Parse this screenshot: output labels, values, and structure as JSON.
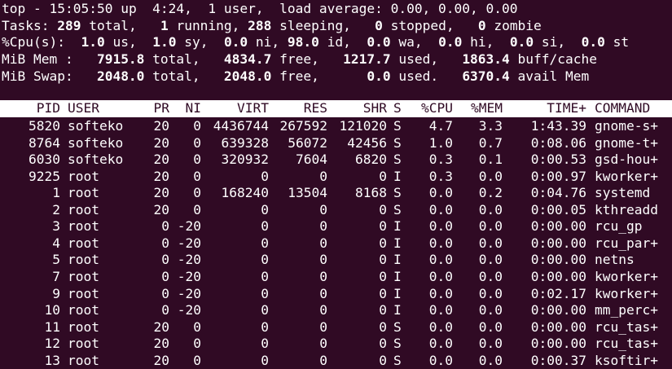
{
  "summary": {
    "uptime_line": {
      "prefix": "top - ",
      "time": "15:05:50",
      "up_label": " up ",
      "uptime": " 4:24,",
      "users": "  1 user,",
      "load_label": "  load average: ",
      "load": "0.00, 0.00, 0.00"
    },
    "tasks": {
      "label": "Tasks: ",
      "total": "289",
      "total_label": " total,   ",
      "running": "1",
      "running_label": " running, ",
      "sleeping": "288",
      "sleeping_label": " sleeping,   ",
      "stopped": "0",
      "stopped_label": " stopped,   ",
      "zombie": "0",
      "zombie_label": " zombie"
    },
    "cpu": {
      "label": "%Cpu(s):  ",
      "us": "1.0",
      "us_label": " us,  ",
      "sy": "1.0",
      "sy_label": " sy,  ",
      "ni": "0.0",
      "ni_label": " ni, ",
      "id": "98.0",
      "id_label": " id,  ",
      "wa": "0.0",
      "wa_label": " wa,  ",
      "hi": "0.0",
      "hi_label": " hi,  ",
      "si": "0.0",
      "si_label": " si,  ",
      "st": "0.0",
      "st_label": " st"
    },
    "mem": {
      "label": "MiB Mem :   ",
      "total": "7915.8",
      "total_label": " total,   ",
      "free": "4834.7",
      "free_label": " free,   ",
      "used": "1217.7",
      "used_label": " used,   ",
      "buff": "1863.4",
      "buff_label": " buff/cache"
    },
    "swap": {
      "label": "MiB Swap:   ",
      "total": "2048.0",
      "total_label": " total,   ",
      "free": "2048.0",
      "free_label": " free,      ",
      "used": "0.0",
      "used_label": " used.   ",
      "avail": "6370.4",
      "avail_label": " avail Mem"
    }
  },
  "table": {
    "headers": {
      "pid": "PID",
      "user": "USER",
      "pr": "PR",
      "ni": "NI",
      "virt": "VIRT",
      "res": "RES",
      "shr": "SHR",
      "s": "S",
      "cpu": "%CPU",
      "mem": "%MEM",
      "time": "TIME+",
      "command": "COMMAND"
    },
    "rows": [
      {
        "pid": "5820",
        "user": "softeko",
        "pr": "20",
        "ni": "0",
        "virt": "4436744",
        "res": "267592",
        "shr": "121020",
        "s": "S",
        "cpu": "4.7",
        "mem": "3.3",
        "time": "1:43.39",
        "command": "gnome-s+"
      },
      {
        "pid": "8764",
        "user": "softeko",
        "pr": "20",
        "ni": "0",
        "virt": "639328",
        "res": "56072",
        "shr": "42456",
        "s": "S",
        "cpu": "1.0",
        "mem": "0.7",
        "time": "0:08.06",
        "command": "gnome-t+"
      },
      {
        "pid": "6030",
        "user": "softeko",
        "pr": "20",
        "ni": "0",
        "virt": "320932",
        "res": "7604",
        "shr": "6820",
        "s": "S",
        "cpu": "0.3",
        "mem": "0.1",
        "time": "0:00.53",
        "command": "gsd-hou+"
      },
      {
        "pid": "9225",
        "user": "root",
        "pr": "20",
        "ni": "0",
        "virt": "0",
        "res": "0",
        "shr": "0",
        "s": "I",
        "cpu": "0.3",
        "mem": "0.0",
        "time": "0:00.97",
        "command": "kworker+"
      },
      {
        "pid": "1",
        "user": "root",
        "pr": "20",
        "ni": "0",
        "virt": "168240",
        "res": "13504",
        "shr": "8168",
        "s": "S",
        "cpu": "0.0",
        "mem": "0.2",
        "time": "0:04.76",
        "command": "systemd"
      },
      {
        "pid": "2",
        "user": "root",
        "pr": "20",
        "ni": "0",
        "virt": "0",
        "res": "0",
        "shr": "0",
        "s": "S",
        "cpu": "0.0",
        "mem": "0.0",
        "time": "0:00.05",
        "command": "kthreadd"
      },
      {
        "pid": "3",
        "user": "root",
        "pr": "0",
        "ni": "-20",
        "virt": "0",
        "res": "0",
        "shr": "0",
        "s": "I",
        "cpu": "0.0",
        "mem": "0.0",
        "time": "0:00.00",
        "command": "rcu_gp"
      },
      {
        "pid": "4",
        "user": "root",
        "pr": "0",
        "ni": "-20",
        "virt": "0",
        "res": "0",
        "shr": "0",
        "s": "I",
        "cpu": "0.0",
        "mem": "0.0",
        "time": "0:00.00",
        "command": "rcu_par+"
      },
      {
        "pid": "5",
        "user": "root",
        "pr": "0",
        "ni": "-20",
        "virt": "0",
        "res": "0",
        "shr": "0",
        "s": "I",
        "cpu": "0.0",
        "mem": "0.0",
        "time": "0:00.00",
        "command": "netns"
      },
      {
        "pid": "7",
        "user": "root",
        "pr": "0",
        "ni": "-20",
        "virt": "0",
        "res": "0",
        "shr": "0",
        "s": "I",
        "cpu": "0.0",
        "mem": "0.0",
        "time": "0:00.00",
        "command": "kworker+"
      },
      {
        "pid": "9",
        "user": "root",
        "pr": "0",
        "ni": "-20",
        "virt": "0",
        "res": "0",
        "shr": "0",
        "s": "I",
        "cpu": "0.0",
        "mem": "0.0",
        "time": "0:02.17",
        "command": "kworker+"
      },
      {
        "pid": "10",
        "user": "root",
        "pr": "0",
        "ni": "-20",
        "virt": "0",
        "res": "0",
        "shr": "0",
        "s": "I",
        "cpu": "0.0",
        "mem": "0.0",
        "time": "0:00.00",
        "command": "mm_perc+"
      },
      {
        "pid": "11",
        "user": "root",
        "pr": "20",
        "ni": "0",
        "virt": "0",
        "res": "0",
        "shr": "0",
        "s": "S",
        "cpu": "0.0",
        "mem": "0.0",
        "time": "0:00.00",
        "command": "rcu_tas+"
      },
      {
        "pid": "12",
        "user": "root",
        "pr": "20",
        "ni": "0",
        "virt": "0",
        "res": "0",
        "shr": "0",
        "s": "S",
        "cpu": "0.0",
        "mem": "0.0",
        "time": "0:00.00",
        "command": "rcu_tas+"
      },
      {
        "pid": "13",
        "user": "root",
        "pr": "20",
        "ni": "0",
        "virt": "0",
        "res": "0",
        "shr": "0",
        "s": "S",
        "cpu": "0.0",
        "mem": "0.0",
        "time": "0:00.37",
        "command": "ksoftir+"
      }
    ]
  },
  "colors": {
    "background": "#300a24",
    "foreground": "#ffffff"
  }
}
